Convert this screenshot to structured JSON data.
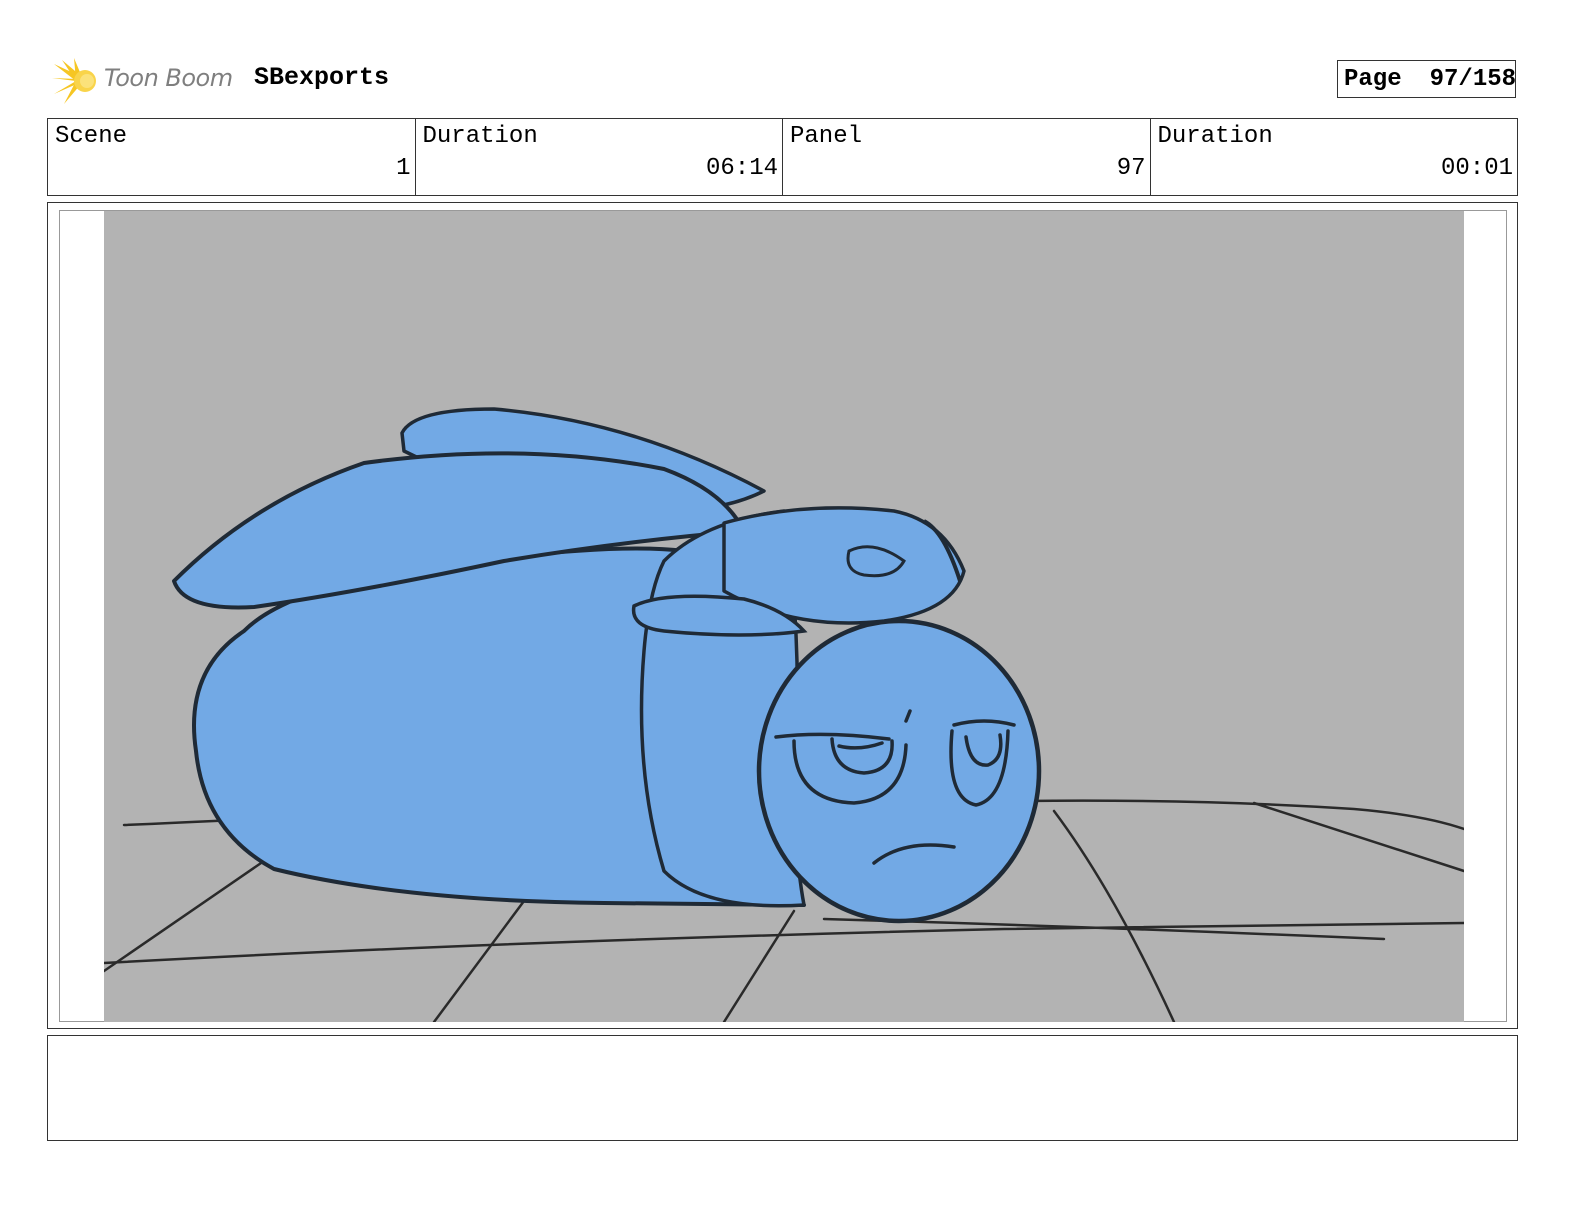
{
  "header": {
    "logo_text": "Toon Boom",
    "project_name": "SBexports",
    "page_label": "Page",
    "page_value": "97/158"
  },
  "info": {
    "scene_label": "Scene",
    "scene_value": "1",
    "scene_duration_label": "Duration",
    "scene_duration_value": "06:14",
    "panel_label": "Panel",
    "panel_value": "97",
    "panel_duration_label": "Duration",
    "panel_duration_value": "00:01"
  },
  "colors": {
    "background_gray": "#b3b3b3",
    "character_blue": "#72a9e5",
    "sketch_line": "#1f2a36",
    "logo_yellow": "#f6c623",
    "logo_text_gray": "#7f7f7f"
  },
  "notes": {
    "text": ""
  }
}
